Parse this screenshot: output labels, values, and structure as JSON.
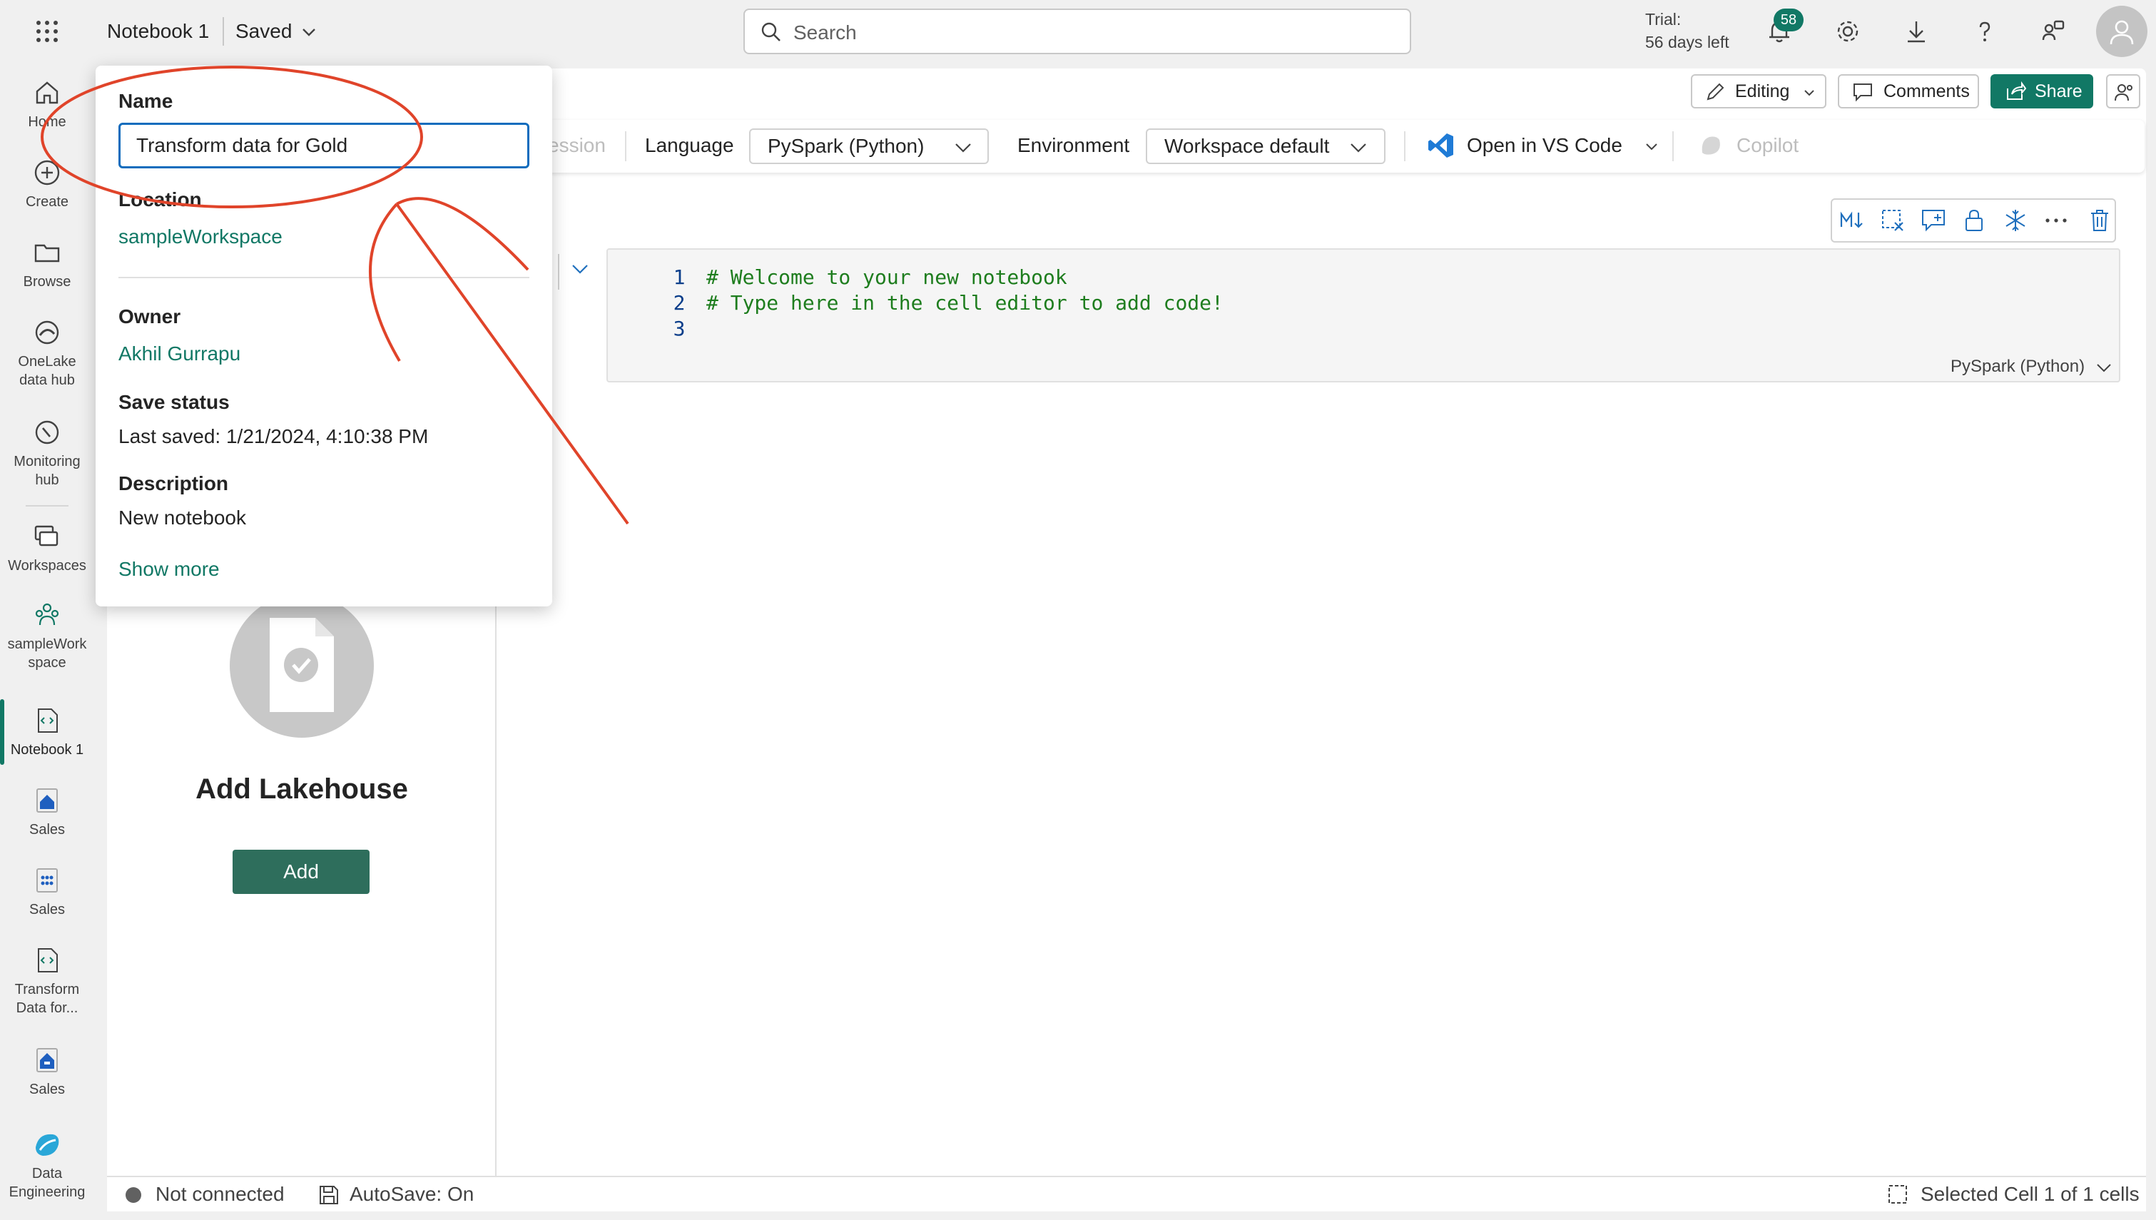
{
  "topbar": {
    "notebook_name": "Notebook 1",
    "save_state": "Saved",
    "search_placeholder": "Search",
    "trial_label": "Trial:",
    "trial_days": "56 days left",
    "notification_count": "58"
  },
  "rail": {
    "items": [
      {
        "label": "Home",
        "icon": "home-icon"
      },
      {
        "label": "Create",
        "icon": "plus-circle-icon"
      },
      {
        "label": "Browse",
        "icon": "folder-icon"
      },
      {
        "label_line1": "OneLake",
        "label_line2": "data hub",
        "icon": "onelake-icon"
      },
      {
        "label_line1": "Monitoring",
        "label_line2": "hub",
        "icon": "monitor-icon"
      },
      {
        "label": "Workspaces",
        "icon": "workspaces-icon"
      },
      {
        "label_line1": "sampleWork",
        "label_line2": "space",
        "icon": "people-icon"
      },
      {
        "label": "Notebook 1",
        "icon": "notebook-icon"
      },
      {
        "label": "Sales",
        "icon": "lakehouse-icon"
      },
      {
        "label": "Sales",
        "icon": "semantic-model-icon"
      },
      {
        "label_line1": "Transform",
        "label_line2": "Data for...",
        "icon": "notebook-icon"
      },
      {
        "label": "Sales",
        "icon": "warehouse-icon"
      },
      {
        "label_line1": "Data",
        "label_line2": "Engineering",
        "icon": "data-engineering-icon"
      }
    ]
  },
  "header_actions": {
    "editing": "Editing",
    "comments": "Comments",
    "share": "Share"
  },
  "ribbon": {
    "session_partial": "ession",
    "language_label": "Language",
    "language_value": "PySpark (Python)",
    "environment_label": "Environment",
    "environment_value": "Workspace default",
    "vscode": "Open in VS Code",
    "copilot": "Copilot"
  },
  "cell": {
    "lines": [
      {
        "num": "1",
        "code": "# Welcome to your new notebook"
      },
      {
        "num": "2",
        "code": "# Type here in the cell editor to add code!"
      },
      {
        "num": "3",
        "code": ""
      }
    ],
    "language": "PySpark (Python)"
  },
  "lakehouse": {
    "title": "Add Lakehouse",
    "button": "Add"
  },
  "popup": {
    "name_label": "Name",
    "name_value": "Transform data for Gold",
    "location_label": "Location",
    "location_value": "sampleWorkspace",
    "owner_label": "Owner",
    "owner_value": "Akhil Gurrapu",
    "save_status_label": "Save status",
    "save_status_value": "Last saved: 1/21/2024, 4:10:38 PM",
    "description_label": "Description",
    "description_value": "New notebook",
    "show_more": "Show more"
  },
  "statusbar": {
    "connection": "Not connected",
    "autosave": "AutoSave: On",
    "selection": "Selected Cell 1 of 1 cells"
  },
  "colors": {
    "accent": "#117865",
    "annotation": "#e0442a",
    "focus": "#0f6cbd",
    "code_comment": "#1e7d1e"
  }
}
